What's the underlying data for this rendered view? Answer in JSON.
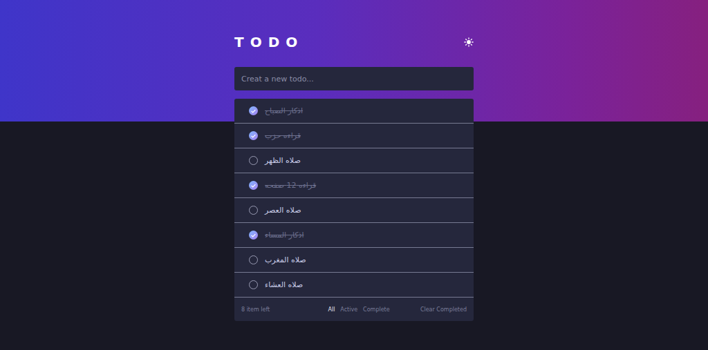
{
  "header": {
    "title": "TODO"
  },
  "input": {
    "placeholder": "Creat a new todo..."
  },
  "todos": [
    {
      "text": "اذكار الصباح",
      "checked": true
    },
    {
      "text": "قراءه حزب",
      "checked": true
    },
    {
      "text": "صلاه الظهر",
      "checked": false
    },
    {
      "text": "قراءه 12 صفحه",
      "checked": true
    },
    {
      "text": "صلاه العصر",
      "checked": false
    },
    {
      "text": "اذكار المساء",
      "checked": true
    },
    {
      "text": "صلاه المغرب",
      "checked": false
    },
    {
      "text": "صلاه العشاء",
      "checked": false
    }
  ],
  "footer": {
    "count": "8 item left",
    "filters": [
      {
        "label": "All",
        "selected": true
      },
      {
        "label": "Active",
        "selected": false
      },
      {
        "label": "Complete",
        "selected": false
      }
    ],
    "clear": "Clear Completed"
  }
}
